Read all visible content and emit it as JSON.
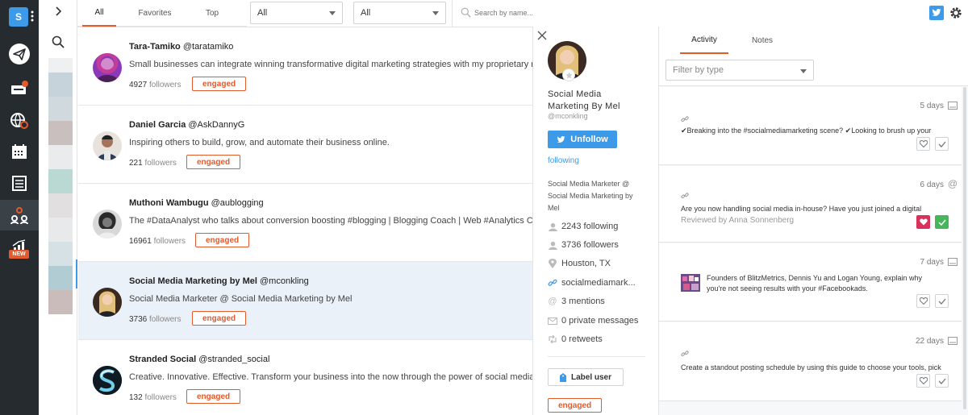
{
  "app": {
    "brand_letter": "S",
    "nav_new_badge": "NEW",
    "accent": "#e35a2b",
    "nav_bg": "#262b30"
  },
  "tabs": [
    {
      "label": "All",
      "active": true
    },
    {
      "label": "Favorites",
      "active": false
    },
    {
      "label": "Top",
      "active": false
    }
  ],
  "filters": {
    "select1_value": "All",
    "select2_value": "All",
    "search_placeholder": "Search by name..."
  },
  "users": [
    {
      "name": "Tara-Tamiko",
      "handle": "@taratamiko",
      "bio": "Small businesses can integrate winning transformative digital marketing strategies with my proprietary m",
      "followers": "4927",
      "followers_label": "followers",
      "label": "engaged",
      "selected": false,
      "avatar_color": "#8a3ab9"
    },
    {
      "name": "Daniel Garcia",
      "handle": "@AskDannyG",
      "bio": "Inspiring others to build, grow, and automate their business online.",
      "followers": "221",
      "followers_label": "followers",
      "label": "engaged",
      "selected": false,
      "avatar_color": "#e7e2dc"
    },
    {
      "name": "Muthoni Wambugu",
      "handle": "@aublogging",
      "bio": "The #DataAnalyst who talks about conversion boosting #blogging | Blogging Coach | Web #Analytics C",
      "followers": "16961",
      "followers_label": "followers",
      "label": "engaged",
      "selected": false,
      "avatar_color": "#d8d8d8"
    },
    {
      "name": "Social Media Marketing by Mel",
      "handle": "@mconkling",
      "bio": "Social Media Marketer @ Social Media Marketing by Mel",
      "followers": "3736",
      "followers_label": "followers",
      "label": "engaged",
      "selected": true,
      "avatar_color": "#c9a27a"
    },
    {
      "name": "Stranded Social",
      "handle": "@stranded_social",
      "bio": "Creative. Innovative. Effective. Transform your business into the now through the power of social media",
      "followers": "132",
      "followers_label": "followers",
      "label": "engaged",
      "selected": false,
      "avatar_color": "#16344a"
    }
  ],
  "profile": {
    "name_line1": "Social Media",
    "name_line2": "Marketing By Mel",
    "handle": "@mconkling",
    "unfollow_label": "Unfollow",
    "following_status": "following",
    "bio_line1": "Social Media Marketer @",
    "bio_line2": "Social Media Marketing by",
    "bio_line3": "Mel",
    "following_count": "2243 following",
    "followers_count": "3736 followers",
    "location": "Houston, TX",
    "website": "socialmediamark...",
    "mentions": "3 mentions",
    "private_messages": "0 private messages",
    "retweets": "0 retweets",
    "label_user_button": "Label user",
    "label": "engaged",
    "unfollow_color": "#3d9ae8"
  },
  "activity_panel": {
    "tabs": [
      {
        "label": "Activity",
        "active": true
      },
      {
        "label": "Notes",
        "active": false
      }
    ],
    "filter_placeholder": "Filter by type",
    "items": [
      {
        "days": "5 days",
        "line1": "✔Breaking into the #socialmediamarketing scene? ✔Looking to brush up your",
        "line2": "",
        "reviewed": "",
        "liked": false,
        "checked": false
      },
      {
        "days": "6 days",
        "line1": "Are you now handling social media in-house? Have you just joined a digital",
        "line2": "",
        "reviewed": "Reviewed by Anna Sonnenberg",
        "liked": true,
        "checked": true
      },
      {
        "days": "7 days",
        "line1": "Founders of BlitzMetrics, Dennis Yu and Logan Young, explain why",
        "line2": "you're not seeing results with your #Facebookads.",
        "reviewed": "",
        "liked": false,
        "checked": false
      },
      {
        "days": "22 days",
        "line1": "Create a standout posting schedule by using this guide to choose your tools, pick",
        "line2": "",
        "reviewed": "",
        "liked": false,
        "checked": false
      }
    ]
  }
}
